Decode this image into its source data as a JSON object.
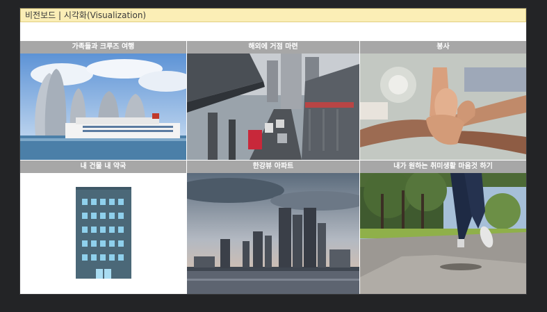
{
  "window": {
    "title": "비전보드 | 시각화(Visualization)"
  },
  "board": {
    "cards": [
      {
        "label": "가족들과 크루즈 여행",
        "image": "cruise-city-photo"
      },
      {
        "label": "해외에 거점 마련",
        "image": "city-street-traffic-photo"
      },
      {
        "label": "봉사",
        "image": "stacked-hands-photo"
      },
      {
        "label": "내 건물 내 약국",
        "image": "building-icon"
      },
      {
        "label": "한강뷰 아파트",
        "image": "river-skyline-photo"
      },
      {
        "label": "내가 원하는 취미생활 마음것 하기",
        "image": "running-park-photo"
      }
    ]
  },
  "colors": {
    "title_bar_bg": "#fbeeb6",
    "card_header_bg": "#a7a7a7",
    "building": "#3f5867"
  }
}
